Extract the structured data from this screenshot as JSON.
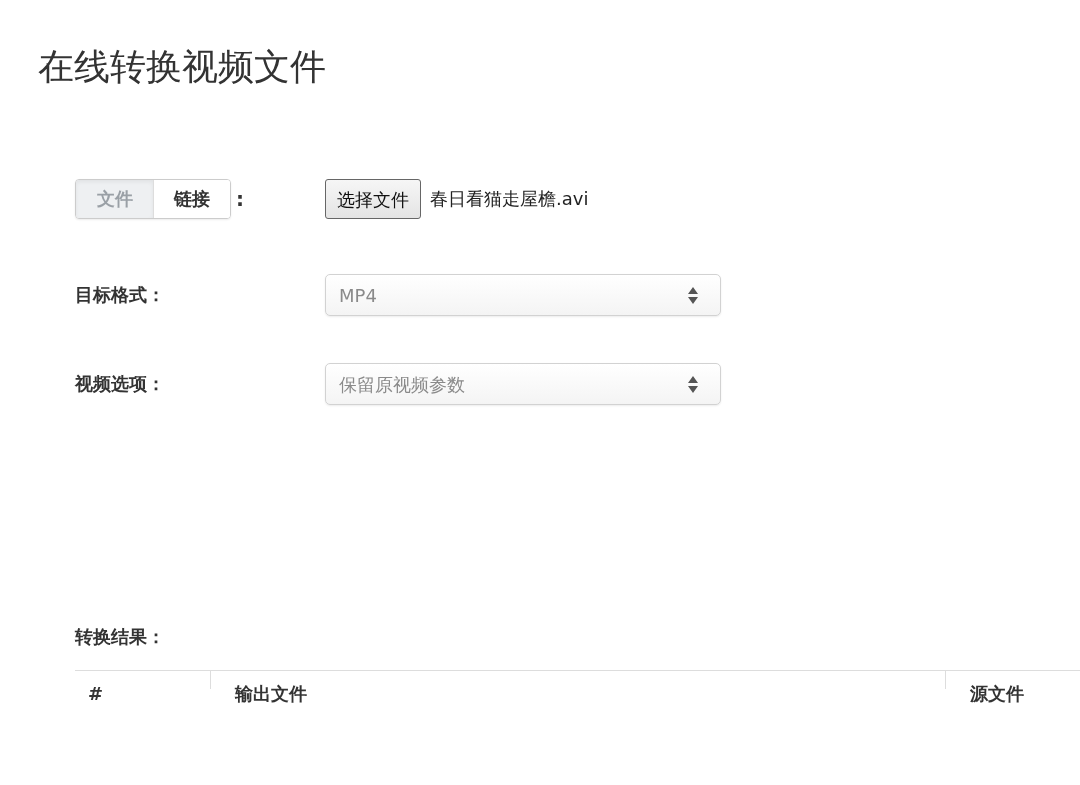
{
  "title": "在线转换视频文件",
  "source": {
    "tabs": [
      {
        "label": "文件",
        "selected": true
      },
      {
        "label": "链接",
        "selected": false
      }
    ],
    "colon": ":",
    "file_button": "选择文件",
    "file_name": "春日看猫走屋檐.avi"
  },
  "fields": [
    {
      "label": "目标格式：",
      "value": "MP4"
    },
    {
      "label": "视频选项：",
      "value": "保留原视频参数"
    }
  ],
  "results": {
    "label": "转换结果：",
    "columns": [
      "#",
      "输出文件",
      "源文件"
    ]
  }
}
